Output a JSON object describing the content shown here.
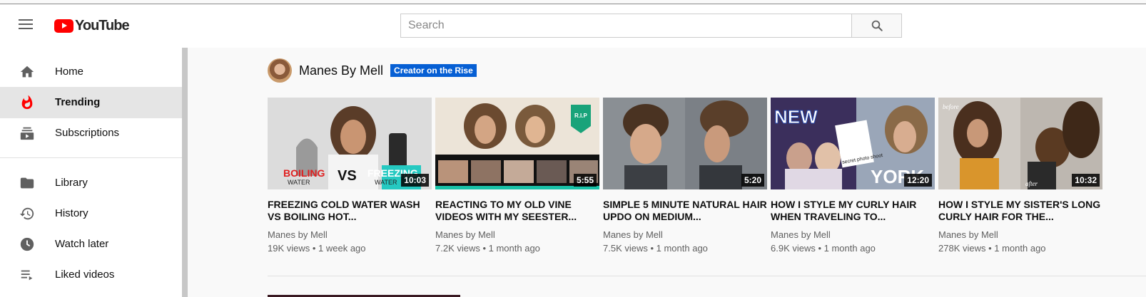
{
  "masthead": {
    "logo_text": "YouTube",
    "search_placeholder": "Search"
  },
  "sidebar": {
    "items": [
      {
        "label": "Home",
        "icon": "home-icon"
      },
      {
        "label": "Trending",
        "icon": "trending-flame-icon",
        "active": true
      },
      {
        "label": "Subscriptions",
        "icon": "subscriptions-icon"
      },
      {
        "label": "Library",
        "icon": "folder-icon"
      },
      {
        "label": "History",
        "icon": "history-icon"
      },
      {
        "label": "Watch later",
        "icon": "clock-icon"
      },
      {
        "label": "Liked videos",
        "icon": "playlist-icon"
      }
    ]
  },
  "shelf": {
    "channel_name": "Manes By Mell",
    "badge": "Creator on the Rise",
    "videos": [
      {
        "title": "FREEZING COLD WATER WASH VS BOILING HOT...",
        "duration": "10:03",
        "channel": "Manes by Mell",
        "meta": "19K views • 1 week ago"
      },
      {
        "title": "REACTING TO MY OLD VINE VIDEOS WITH MY SEESTER...",
        "duration": "5:55",
        "channel": "Manes by Mell",
        "meta": "7.2K views • 1 month ago"
      },
      {
        "title": "SIMPLE 5 MINUTE NATURAL HAIR UPDO ON MEDIUM...",
        "duration": "5:20",
        "channel": "Manes by Mell",
        "meta": "7.5K views • 1 month ago"
      },
      {
        "title": "HOW I STYLE MY CURLY HAIR WHEN TRAVELING TO...",
        "duration": "12:20",
        "channel": "Manes by Mell",
        "meta": "6.9K views • 1 month ago"
      },
      {
        "title": "HOW I STYLE MY SISTER'S LONG CURLY HAIR FOR THE...",
        "duration": "10:32",
        "channel": "Manes by Mell",
        "meta": "278K views • 1 month ago"
      }
    ]
  },
  "thumb_text": {
    "t1_left": "BOILING",
    "t1_left_sub": "WATER",
    "t1_vs": "VS",
    "t1_right": "FREEZING",
    "t1_right_sub": "WATER",
    "t2_rip": "R.I.P",
    "t4_new": "NEW",
    "t4_york": "YORK",
    "t4_polaroid": "secret photo shoot",
    "t5_before": "before",
    "t5_after": "after"
  },
  "colors": {
    "brand_red": "#ff0000",
    "badge_blue": "#065fd4",
    "active_bg": "#e5e5e5"
  }
}
